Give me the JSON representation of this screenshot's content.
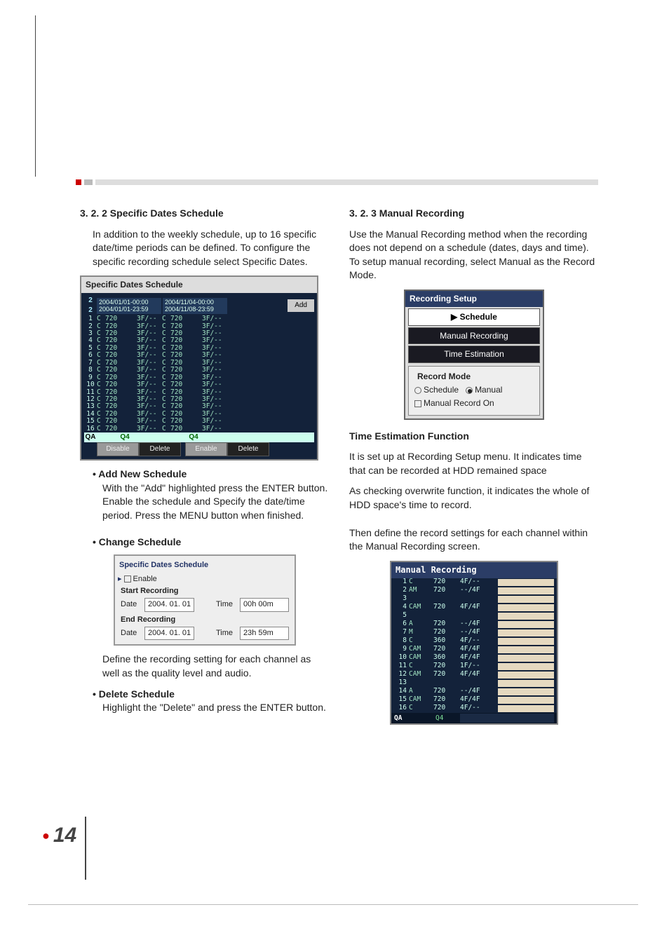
{
  "page_number": "14",
  "left": {
    "heading": "3. 2. 2 Specific Dates Schedule",
    "intro": "In addition to the weekly schedule, up to 16 specific date/time periods can be defined. To configure the specific recording schedule select Specific Dates.",
    "fig_title": "Specific Dates Schedule",
    "fig_sel_index": "2",
    "fig_header_a_line1": "2004/01/01-00:00",
    "fig_header_a_line2": "2004/01/01-23:59",
    "fig_header_b_line1": "2004/11/04-00:00",
    "fig_header_b_line2": "2004/11/08-23:59",
    "add_label": "Add",
    "rows": [
      {
        "i": "1",
        "c1": "C",
        "r1": "720",
        "f1": "3F/--",
        "c2": "C",
        "r2": "720",
        "f2": "3F/--"
      },
      {
        "i": "2",
        "c1": "C",
        "r1": "720",
        "f1": "3F/--",
        "c2": "C",
        "r2": "720",
        "f2": "3F/--"
      },
      {
        "i": "3",
        "c1": "C",
        "r1": "720",
        "f1": "3F/--",
        "c2": "C",
        "r2": "720",
        "f2": "3F/--"
      },
      {
        "i": "4",
        "c1": "C",
        "r1": "720",
        "f1": "3F/--",
        "c2": "C",
        "r2": "720",
        "f2": "3F/--"
      },
      {
        "i": "5",
        "c1": "C",
        "r1": "720",
        "f1": "3F/--",
        "c2": "C",
        "r2": "720",
        "f2": "3F/--"
      },
      {
        "i": "6",
        "c1": "C",
        "r1": "720",
        "f1": "3F/--",
        "c2": "C",
        "r2": "720",
        "f2": "3F/--"
      },
      {
        "i": "7",
        "c1": "C",
        "r1": "720",
        "f1": "3F/--",
        "c2": "C",
        "r2": "720",
        "f2": "3F/--"
      },
      {
        "i": "8",
        "c1": "C",
        "r1": "720",
        "f1": "3F/--",
        "c2": "C",
        "r2": "720",
        "f2": "3F/--"
      },
      {
        "i": "9",
        "c1": "C",
        "r1": "720",
        "f1": "3F/--",
        "c2": "C",
        "r2": "720",
        "f2": "3F/--"
      },
      {
        "i": "10",
        "c1": "C",
        "r1": "720",
        "f1": "3F/--",
        "c2": "C",
        "r2": "720",
        "f2": "3F/--"
      },
      {
        "i": "11",
        "c1": "C",
        "r1": "720",
        "f1": "3F/--",
        "c2": "C",
        "r2": "720",
        "f2": "3F/--"
      },
      {
        "i": "12",
        "c1": "C",
        "r1": "720",
        "f1": "3F/--",
        "c2": "C",
        "r2": "720",
        "f2": "3F/--"
      },
      {
        "i": "13",
        "c1": "C",
        "r1": "720",
        "f1": "3F/--",
        "c2": "C",
        "r2": "720",
        "f2": "3F/--"
      },
      {
        "i": "14",
        "c1": "C",
        "r1": "720",
        "f1": "3F/--",
        "c2": "C",
        "r2": "720",
        "f2": "3F/--"
      },
      {
        "i": "15",
        "c1": "C",
        "r1": "720",
        "f1": "3F/--",
        "c2": "C",
        "r2": "720",
        "f2": "3F/--"
      },
      {
        "i": "16",
        "c1": "C",
        "r1": "720",
        "f1": "3F/--",
        "c2": "C",
        "r2": "720",
        "f2": "3F/--"
      }
    ],
    "qa_label": "QA",
    "qa_val_a": "Q4",
    "qa_val_b": "Q4",
    "btn_disable": "Disable",
    "btn_delete": "Delete",
    "btn_enable": "Enable",
    "bullet1_title": "Add New Schedule",
    "bullet1_body": "With the \"Add\" highlighted press the ENTER button. Enable the schedule and Specify the date/time period. Press the MENU button when finished.",
    "bullet2_title": "Change Schedule",
    "dlg_title": "Specific Dates Schedule",
    "dlg_enable": "Enable",
    "dlg_start": "Start Recording",
    "dlg_date_label": "Date",
    "dlg_start_date": "2004. 01. 01",
    "dlg_time_label": "Time",
    "dlg_start_time": "00h 00m",
    "dlg_end": "End Recording",
    "dlg_end_date": "2004. 01. 01",
    "dlg_end_time": "23h 59m",
    "bullet2_body": "Define the recording setting for each channel as well as the quality level and audio.",
    "bullet3_title": "Delete Schedule",
    "bullet3_body": "Highlight the \"Delete\" and press the ENTER button."
  },
  "right": {
    "heading": "3. 2. 3 Manual Recording",
    "intro": "Use the Manual Recording method when the recording does not depend on a schedule (dates, days and time). To setup manual recording, select Manual as the Record Mode.",
    "rs_title": "Recording Setup",
    "rs_item_schedule": "Schedule",
    "rs_item_manual": "Manual Recording",
    "rs_item_time": "Time Estimation",
    "rs_group_legend": "Record Mode",
    "rs_opt_schedule": "Schedule",
    "rs_opt_manual": "Manual",
    "rs_chk_label": "Manual Record On",
    "sub_heading": "Time Estimation Function",
    "sub_body1": "It is set up at Recording Setup menu. It indicates time that can be recorded at HDD remained space",
    "sub_body2": "As checking overwrite function, it indicates the whole of HDD space's time to record.",
    "then_body": "Then define the record settings for each channel within the Manual Recording screen.",
    "mr_title": "Manual Recording",
    "mr_rows": [
      {
        "i": "1",
        "m": "C",
        "r": "720",
        "f": "4F/--"
      },
      {
        "i": "2",
        "m": "AM",
        "r": "720",
        "f": "--/4F"
      },
      {
        "i": "3",
        "m": "",
        "r": "",
        "f": ""
      },
      {
        "i": "4",
        "m": "CAM",
        "r": "720",
        "f": "4F/4F"
      },
      {
        "i": "5",
        "m": "",
        "r": "",
        "f": ""
      },
      {
        "i": "6",
        "m": "A",
        "r": "720",
        "f": "--/4F"
      },
      {
        "i": "7",
        "m": "M",
        "r": "720",
        "f": "--/4F"
      },
      {
        "i": "8",
        "m": "C",
        "r": "360",
        "f": "4F/--"
      },
      {
        "i": "9",
        "m": "CAM",
        "r": "720",
        "f": "4F/4F"
      },
      {
        "i": "10",
        "m": "CAM",
        "r": "360",
        "f": "4F/4F"
      },
      {
        "i": "11",
        "m": "C",
        "r": "720",
        "f": "1F/--"
      },
      {
        "i": "12",
        "m": "CAM",
        "r": "720",
        "f": "4F/4F"
      },
      {
        "i": "13",
        "m": "",
        "r": "",
        "f": ""
      },
      {
        "i": "14",
        "m": "A",
        "r": "720",
        "f": "--/4F"
      },
      {
        "i": "15",
        "m": "CAM",
        "r": "720",
        "f": "4F/4F"
      },
      {
        "i": "16",
        "m": "C",
        "r": "720",
        "f": "4F/--"
      }
    ],
    "mr_qa_label": "QA",
    "mr_qa_val": "Q4"
  }
}
